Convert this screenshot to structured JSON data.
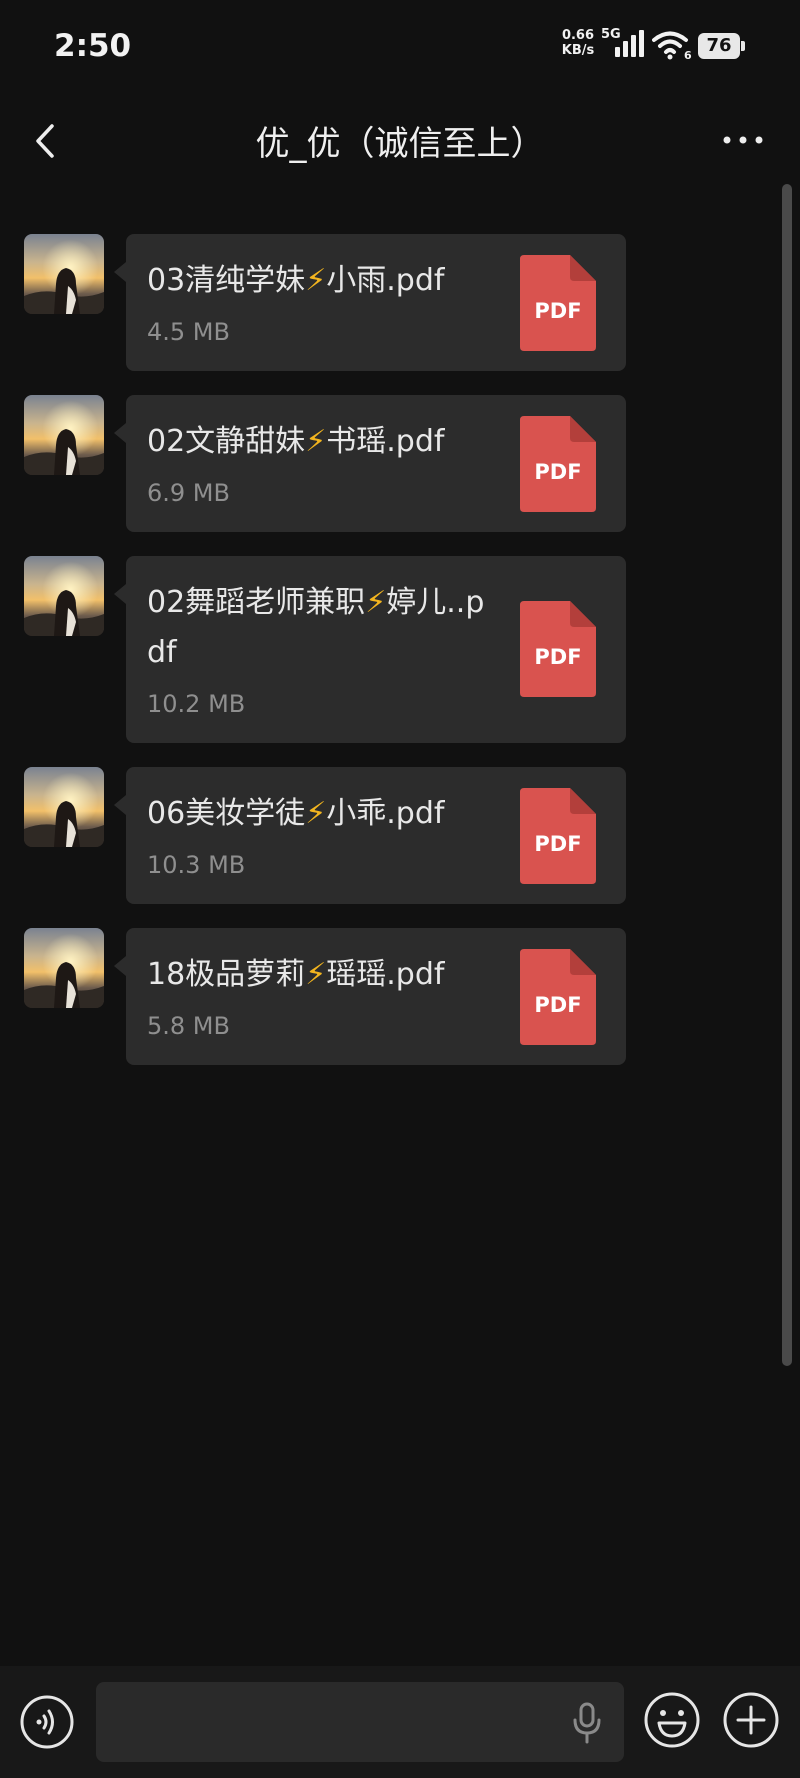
{
  "status_bar": {
    "time": "2:50",
    "net_speed_value": "0.66",
    "net_speed_unit": "KB/s",
    "network_type": "5G",
    "wifi_sub": "6",
    "battery": "76"
  },
  "header": {
    "title": "优_优（诚信至上）",
    "back_icon": "chevron-left-icon",
    "more_icon": "more-dots-icon"
  },
  "messages": [
    {
      "name_pre": "03清纯学妹",
      "bolt": "⚡",
      "name_post": "小雨.pdf",
      "size": "4.5 MB",
      "file_type": "PDF"
    },
    {
      "name_pre": "02文静甜妹",
      "bolt": "⚡",
      "name_post": "书瑶.pdf",
      "size": "6.9 MB",
      "file_type": "PDF"
    },
    {
      "name_pre": "02舞蹈老师兼职",
      "bolt": "⚡",
      "name_post": "婷儿..pdf",
      "size": "10.2 MB",
      "file_type": "PDF"
    },
    {
      "name_pre": "06美妆学徒",
      "bolt": "⚡",
      "name_post": "小乖.pdf",
      "size": "10.3 MB",
      "file_type": "PDF"
    },
    {
      "name_pre": "18极品萝莉",
      "bolt": "⚡",
      "name_post": "瑶瑶.pdf",
      "size": "5.8 MB",
      "file_type": "PDF"
    }
  ],
  "input": {
    "placeholder": ""
  },
  "colors": {
    "background": "#111111",
    "bubble": "#2c2c2c",
    "pdf_red": "#d9534f",
    "bolt": "#f3b51f"
  }
}
